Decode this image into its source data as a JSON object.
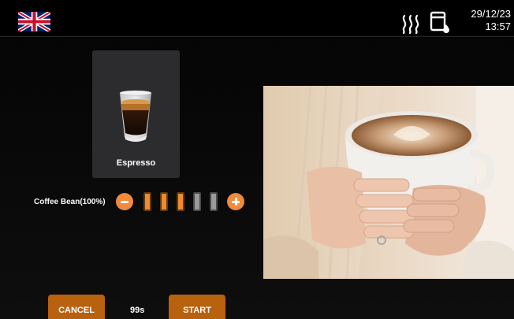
{
  "status_bar": {
    "language_icon": "uk-flag-icon",
    "steam_icon": "steam-heating-icon",
    "tank_icon": "water-tank-icon",
    "date": "29/12/23",
    "time": "13:57"
  },
  "product": {
    "name": "Espresso",
    "icon": "espresso-cup-icon"
  },
  "strength": {
    "label": "Coffee Bean(100%)",
    "level": 3,
    "max_level": 5,
    "decrease_icon": "minus-icon",
    "increase_icon": "plus-icon"
  },
  "actions": {
    "cancel_label": "CANCEL",
    "timer": "99s",
    "start_label": "START"
  },
  "colors": {
    "accent": "#f08a2a",
    "button": "#b8610f",
    "card": "#2c2c2e",
    "background": "#000000"
  }
}
